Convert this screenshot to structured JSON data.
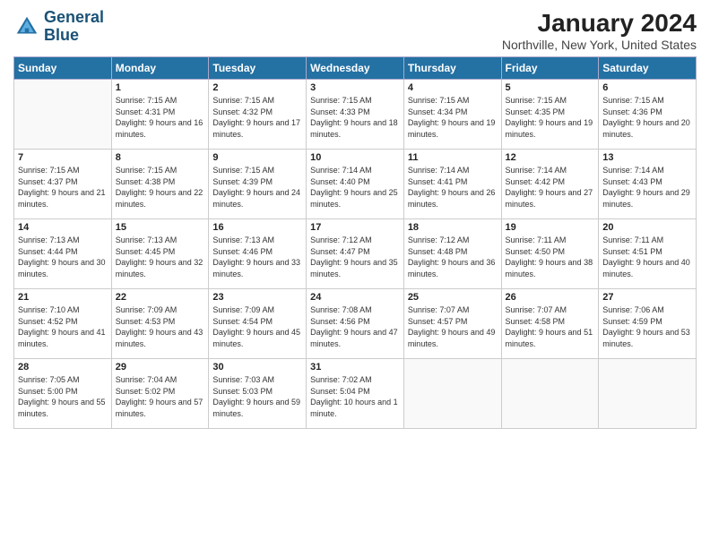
{
  "app": {
    "name": "GeneralBlue",
    "logo_line1": "General",
    "logo_line2": "Blue"
  },
  "calendar": {
    "month": "January 2024",
    "location": "Northville, New York, United States",
    "days_of_week": [
      "Sunday",
      "Monday",
      "Tuesday",
      "Wednesday",
      "Thursday",
      "Friday",
      "Saturday"
    ],
    "weeks": [
      [
        {
          "day": "",
          "sunrise": "",
          "sunset": "",
          "daylight": ""
        },
        {
          "day": "1",
          "sunrise": "Sunrise: 7:15 AM",
          "sunset": "Sunset: 4:31 PM",
          "daylight": "Daylight: 9 hours and 16 minutes."
        },
        {
          "day": "2",
          "sunrise": "Sunrise: 7:15 AM",
          "sunset": "Sunset: 4:32 PM",
          "daylight": "Daylight: 9 hours and 17 minutes."
        },
        {
          "day": "3",
          "sunrise": "Sunrise: 7:15 AM",
          "sunset": "Sunset: 4:33 PM",
          "daylight": "Daylight: 9 hours and 18 minutes."
        },
        {
          "day": "4",
          "sunrise": "Sunrise: 7:15 AM",
          "sunset": "Sunset: 4:34 PM",
          "daylight": "Daylight: 9 hours and 19 minutes."
        },
        {
          "day": "5",
          "sunrise": "Sunrise: 7:15 AM",
          "sunset": "Sunset: 4:35 PM",
          "daylight": "Daylight: 9 hours and 19 minutes."
        },
        {
          "day": "6",
          "sunrise": "Sunrise: 7:15 AM",
          "sunset": "Sunset: 4:36 PM",
          "daylight": "Daylight: 9 hours and 20 minutes."
        }
      ],
      [
        {
          "day": "7",
          "sunrise": "Sunrise: 7:15 AM",
          "sunset": "Sunset: 4:37 PM",
          "daylight": "Daylight: 9 hours and 21 minutes."
        },
        {
          "day": "8",
          "sunrise": "Sunrise: 7:15 AM",
          "sunset": "Sunset: 4:38 PM",
          "daylight": "Daylight: 9 hours and 22 minutes."
        },
        {
          "day": "9",
          "sunrise": "Sunrise: 7:15 AM",
          "sunset": "Sunset: 4:39 PM",
          "daylight": "Daylight: 9 hours and 24 minutes."
        },
        {
          "day": "10",
          "sunrise": "Sunrise: 7:14 AM",
          "sunset": "Sunset: 4:40 PM",
          "daylight": "Daylight: 9 hours and 25 minutes."
        },
        {
          "day": "11",
          "sunrise": "Sunrise: 7:14 AM",
          "sunset": "Sunset: 4:41 PM",
          "daylight": "Daylight: 9 hours and 26 minutes."
        },
        {
          "day": "12",
          "sunrise": "Sunrise: 7:14 AM",
          "sunset": "Sunset: 4:42 PM",
          "daylight": "Daylight: 9 hours and 27 minutes."
        },
        {
          "day": "13",
          "sunrise": "Sunrise: 7:14 AM",
          "sunset": "Sunset: 4:43 PM",
          "daylight": "Daylight: 9 hours and 29 minutes."
        }
      ],
      [
        {
          "day": "14",
          "sunrise": "Sunrise: 7:13 AM",
          "sunset": "Sunset: 4:44 PM",
          "daylight": "Daylight: 9 hours and 30 minutes."
        },
        {
          "day": "15",
          "sunrise": "Sunrise: 7:13 AM",
          "sunset": "Sunset: 4:45 PM",
          "daylight": "Daylight: 9 hours and 32 minutes."
        },
        {
          "day": "16",
          "sunrise": "Sunrise: 7:13 AM",
          "sunset": "Sunset: 4:46 PM",
          "daylight": "Daylight: 9 hours and 33 minutes."
        },
        {
          "day": "17",
          "sunrise": "Sunrise: 7:12 AM",
          "sunset": "Sunset: 4:47 PM",
          "daylight": "Daylight: 9 hours and 35 minutes."
        },
        {
          "day": "18",
          "sunrise": "Sunrise: 7:12 AM",
          "sunset": "Sunset: 4:48 PM",
          "daylight": "Daylight: 9 hours and 36 minutes."
        },
        {
          "day": "19",
          "sunrise": "Sunrise: 7:11 AM",
          "sunset": "Sunset: 4:50 PM",
          "daylight": "Daylight: 9 hours and 38 minutes."
        },
        {
          "day": "20",
          "sunrise": "Sunrise: 7:11 AM",
          "sunset": "Sunset: 4:51 PM",
          "daylight": "Daylight: 9 hours and 40 minutes."
        }
      ],
      [
        {
          "day": "21",
          "sunrise": "Sunrise: 7:10 AM",
          "sunset": "Sunset: 4:52 PM",
          "daylight": "Daylight: 9 hours and 41 minutes."
        },
        {
          "day": "22",
          "sunrise": "Sunrise: 7:09 AM",
          "sunset": "Sunset: 4:53 PM",
          "daylight": "Daylight: 9 hours and 43 minutes."
        },
        {
          "day": "23",
          "sunrise": "Sunrise: 7:09 AM",
          "sunset": "Sunset: 4:54 PM",
          "daylight": "Daylight: 9 hours and 45 minutes."
        },
        {
          "day": "24",
          "sunrise": "Sunrise: 7:08 AM",
          "sunset": "Sunset: 4:56 PM",
          "daylight": "Daylight: 9 hours and 47 minutes."
        },
        {
          "day": "25",
          "sunrise": "Sunrise: 7:07 AM",
          "sunset": "Sunset: 4:57 PM",
          "daylight": "Daylight: 9 hours and 49 minutes."
        },
        {
          "day": "26",
          "sunrise": "Sunrise: 7:07 AM",
          "sunset": "Sunset: 4:58 PM",
          "daylight": "Daylight: 9 hours and 51 minutes."
        },
        {
          "day": "27",
          "sunrise": "Sunrise: 7:06 AM",
          "sunset": "Sunset: 4:59 PM",
          "daylight": "Daylight: 9 hours and 53 minutes."
        }
      ],
      [
        {
          "day": "28",
          "sunrise": "Sunrise: 7:05 AM",
          "sunset": "Sunset: 5:00 PM",
          "daylight": "Daylight: 9 hours and 55 minutes."
        },
        {
          "day": "29",
          "sunrise": "Sunrise: 7:04 AM",
          "sunset": "Sunset: 5:02 PM",
          "daylight": "Daylight: 9 hours and 57 minutes."
        },
        {
          "day": "30",
          "sunrise": "Sunrise: 7:03 AM",
          "sunset": "Sunset: 5:03 PM",
          "daylight": "Daylight: 9 hours and 59 minutes."
        },
        {
          "day": "31",
          "sunrise": "Sunrise: 7:02 AM",
          "sunset": "Sunset: 5:04 PM",
          "daylight": "Daylight: 10 hours and 1 minute."
        },
        {
          "day": "",
          "sunrise": "",
          "sunset": "",
          "daylight": ""
        },
        {
          "day": "",
          "sunrise": "",
          "sunset": "",
          "daylight": ""
        },
        {
          "day": "",
          "sunrise": "",
          "sunset": "",
          "daylight": ""
        }
      ]
    ]
  }
}
